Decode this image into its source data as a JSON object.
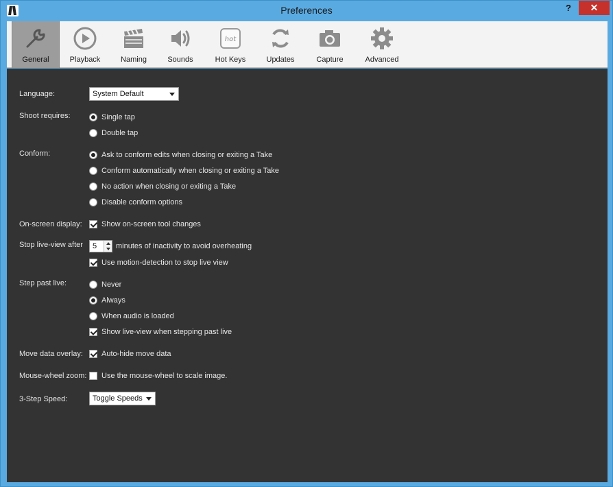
{
  "window": {
    "title": "Preferences",
    "help_label": "?",
    "close_label": "✕"
  },
  "tabs": [
    {
      "label": "General",
      "icon": "wrench-icon",
      "active": true
    },
    {
      "label": "Playback",
      "icon": "play-icon"
    },
    {
      "label": "Naming",
      "icon": "clapperboard-icon"
    },
    {
      "label": "Sounds",
      "icon": "speaker-icon"
    },
    {
      "label": "Hot Keys",
      "icon": "hotkey-icon",
      "icon_text": "hot"
    },
    {
      "label": "Updates",
      "icon": "refresh-icon"
    },
    {
      "label": "Capture",
      "icon": "camera-icon"
    },
    {
      "label": "Advanced",
      "icon": "gear-icon"
    }
  ],
  "general": {
    "language": {
      "label": "Language:",
      "value": "System Default"
    },
    "shoot": {
      "label": "Shoot requires:",
      "options": [
        "Single tap",
        "Double tap"
      ],
      "selected": 0
    },
    "conform": {
      "label": "Conform:",
      "options": [
        "Ask to conform edits when closing or exiting a Take",
        "Conform automatically when closing or exiting a Take",
        "No action when closing or exiting a Take",
        "Disable conform options"
      ],
      "selected": 0
    },
    "osd": {
      "label": "On-screen display:",
      "check": "Show on-screen tool changes",
      "checked": true
    },
    "live_view": {
      "label": "Stop live-view after",
      "minutes": "5",
      "suffix": "minutes of inactivity to avoid overheating",
      "check": "Use motion-detection to stop live view",
      "checked": true
    },
    "step_past": {
      "label": "Step past live:",
      "options": [
        "Never",
        "Always",
        "When audio is loaded"
      ],
      "selected": 1,
      "check": "Show live-view when stepping past live",
      "checked": true
    },
    "move_overlay": {
      "label": "Move data overlay:",
      "check": "Auto-hide move data",
      "checked": true
    },
    "mouse_zoom": {
      "label": "Mouse-wheel zoom:",
      "check": "Use the mouse-wheel to scale image.",
      "checked": false
    },
    "speed": {
      "label": "3-Step Speed:",
      "value": "Toggle Speeds"
    }
  },
  "colors": {
    "accent": "#5aaae2",
    "panel": "#333333",
    "close": "#c7312b",
    "toolbar": "#f3f3f3",
    "active_tab": "#9c9c9c"
  }
}
